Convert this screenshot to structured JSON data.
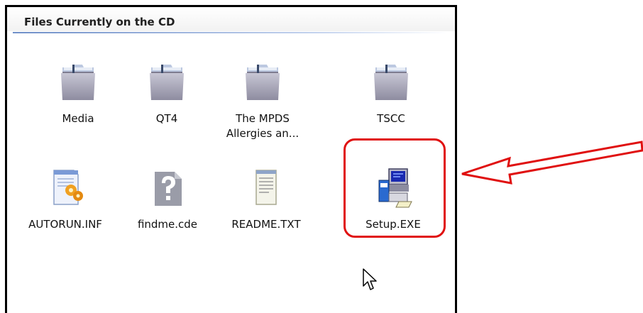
{
  "window": {
    "header_title": "Files Currently on the CD"
  },
  "files": [
    {
      "name": "Media",
      "icon": "folder-icon"
    },
    {
      "name": "QT4",
      "icon": "folder-icon"
    },
    {
      "name": "The MPDS\nAllergies an...",
      "icon": "folder-icon"
    },
    {
      "name": "TSCC",
      "icon": "folder-icon"
    },
    {
      "name": "AUTORUN.INF",
      "icon": "inf-setup-file-icon"
    },
    {
      "name": "findme.cde",
      "icon": "unknown-file-icon"
    },
    {
      "name": "README.TXT",
      "icon": "text-file-icon"
    },
    {
      "name": "Setup.EXE",
      "icon": "setup-program-icon"
    }
  ],
  "annotations": {
    "highlight_color": "#e01010",
    "highlighted_item": "Setup.EXE",
    "arrow": "arrow-pointing-left-icon"
  },
  "cursor": "mouse-pointer-icon"
}
